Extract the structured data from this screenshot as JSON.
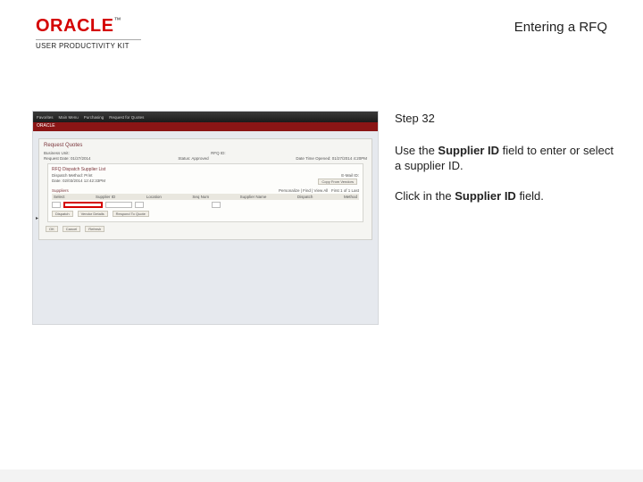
{
  "header": {
    "logo_text": "ORACLE",
    "logo_tm": "™",
    "subbrand": "USER PRODUCTIVITY KIT",
    "page_title": "Entering a RFQ"
  },
  "instructions": {
    "step_label": "Step 32",
    "line1_pre": "Use the ",
    "line1_bold": "Supplier ID",
    "line1_post": " field to enter or select a supplier ID.",
    "line2_pre": "Click in the ",
    "line2_bold": "Supplier ID",
    "line2_post": " field."
  },
  "screenshot": {
    "oracle_bar": "ORACLE",
    "panel_title": "Request Quotes",
    "info1_left": "Business Unit:",
    "info1_right": "RFQ ID:",
    "info2_left": "Request Date: 01/27/2014",
    "info2_mid": "Status: Approved",
    "info2_right": "Date Time Opened: 01/27/2014   4:20PM",
    "sub_title": "RFQ Dispatch Supplier List",
    "dispatch_left": "Dispatch Method: Print",
    "dispatch_right": "E-Mail ID:",
    "date_left": "Date: 02/03/2014 12:42:33PM",
    "btn_copy": "Copy From Vendors",
    "suppliers_label": "Suppliers",
    "hdr_select": "Select",
    "hdr_pid": "Supplier ID",
    "hdr_loc": "Location",
    "hdr_seq": "Seq Num",
    "hdr_name": "Supplier Name",
    "hdr_disp": "Dispatch",
    "hdr_method": "Method",
    "nav_text": "Personalize | Find | View All",
    "nav_count": "First 1 of 1 Last",
    "btn_disp": "Dispatch",
    "btn_details": "Vendor Details",
    "btn_resp": "Respond To Quote",
    "btn_ok": "OK",
    "btn_cancel": "Cancel",
    "btn_refresh": "Refresh"
  }
}
